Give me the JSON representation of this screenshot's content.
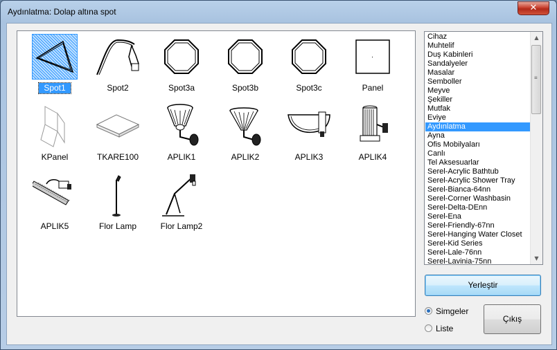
{
  "window": {
    "title": "Aydınlatma:  Dolap altına spot",
    "close_glyph": "✕"
  },
  "icons": [
    {
      "label": "Spot1",
      "icon": "triangle-spot-icon",
      "selected": true
    },
    {
      "label": "Spot2",
      "icon": "curved-spot-icon"
    },
    {
      "label": "Spot3a",
      "icon": "octagon-spot-icon"
    },
    {
      "label": "Spot3b",
      "icon": "octagon-spot-icon"
    },
    {
      "label": "Spot3c",
      "icon": "octagon-spot-icon"
    },
    {
      "label": "Panel",
      "icon": "square-panel-icon"
    },
    {
      "label": "KPanel",
      "icon": "folded-panel-icon"
    },
    {
      "label": "TKARE100",
      "icon": "flat-square-icon"
    },
    {
      "label": "APLIK1",
      "icon": "wall-lamp-icon"
    },
    {
      "label": "APLIK2",
      "icon": "wall-lamp-cone-icon"
    },
    {
      "label": "APLIK3",
      "icon": "wall-lamp-bowl-icon"
    },
    {
      "label": "APLIK4",
      "icon": "wall-lamp-cylinder-icon"
    },
    {
      "label": "APLIK5",
      "icon": "tube-lamp-icon"
    },
    {
      "label": "Flor Lamp",
      "icon": "floor-lamp-icon"
    },
    {
      "label": "Flor Lamp2",
      "icon": "arm-floor-lamp-icon"
    }
  ],
  "categories": [
    "Cihaz",
    "Muhtelif",
    "Duş Kabinleri",
    "Sandalyeler",
    "Masalar",
    "Semboller",
    "Meyve",
    "Şekiller",
    "Mutfak",
    "Eviye",
    "Aydınlatma",
    "Ayna",
    "Ofis Mobilyaları",
    "Canlı",
    "Tel Aksesuarlar",
    "Serel-Acrylic Bathtub",
    "Serel-Acrylic Shower Tray",
    "Serel-Bianca-64nn",
    "Serel-Corner Washbasin",
    "Serel-Delta-DEnn",
    "Serel-Ena",
    "Serel-Friendly-67nn",
    "Serel-Hanging Water Closet",
    "Serel-Kid Series",
    "Serel-Lale-76nn",
    "Serel-Lavinia-75nn"
  ],
  "selected_category": "Aydınlatma",
  "buttons": {
    "place": "Yerleştir",
    "exit": "Çıkış"
  },
  "view_options": {
    "icons": "Simgeler",
    "list": "Liste",
    "selected": "Simgeler"
  },
  "colors": {
    "selection": "#3399ff",
    "titlebar": "#b9d1ea"
  }
}
